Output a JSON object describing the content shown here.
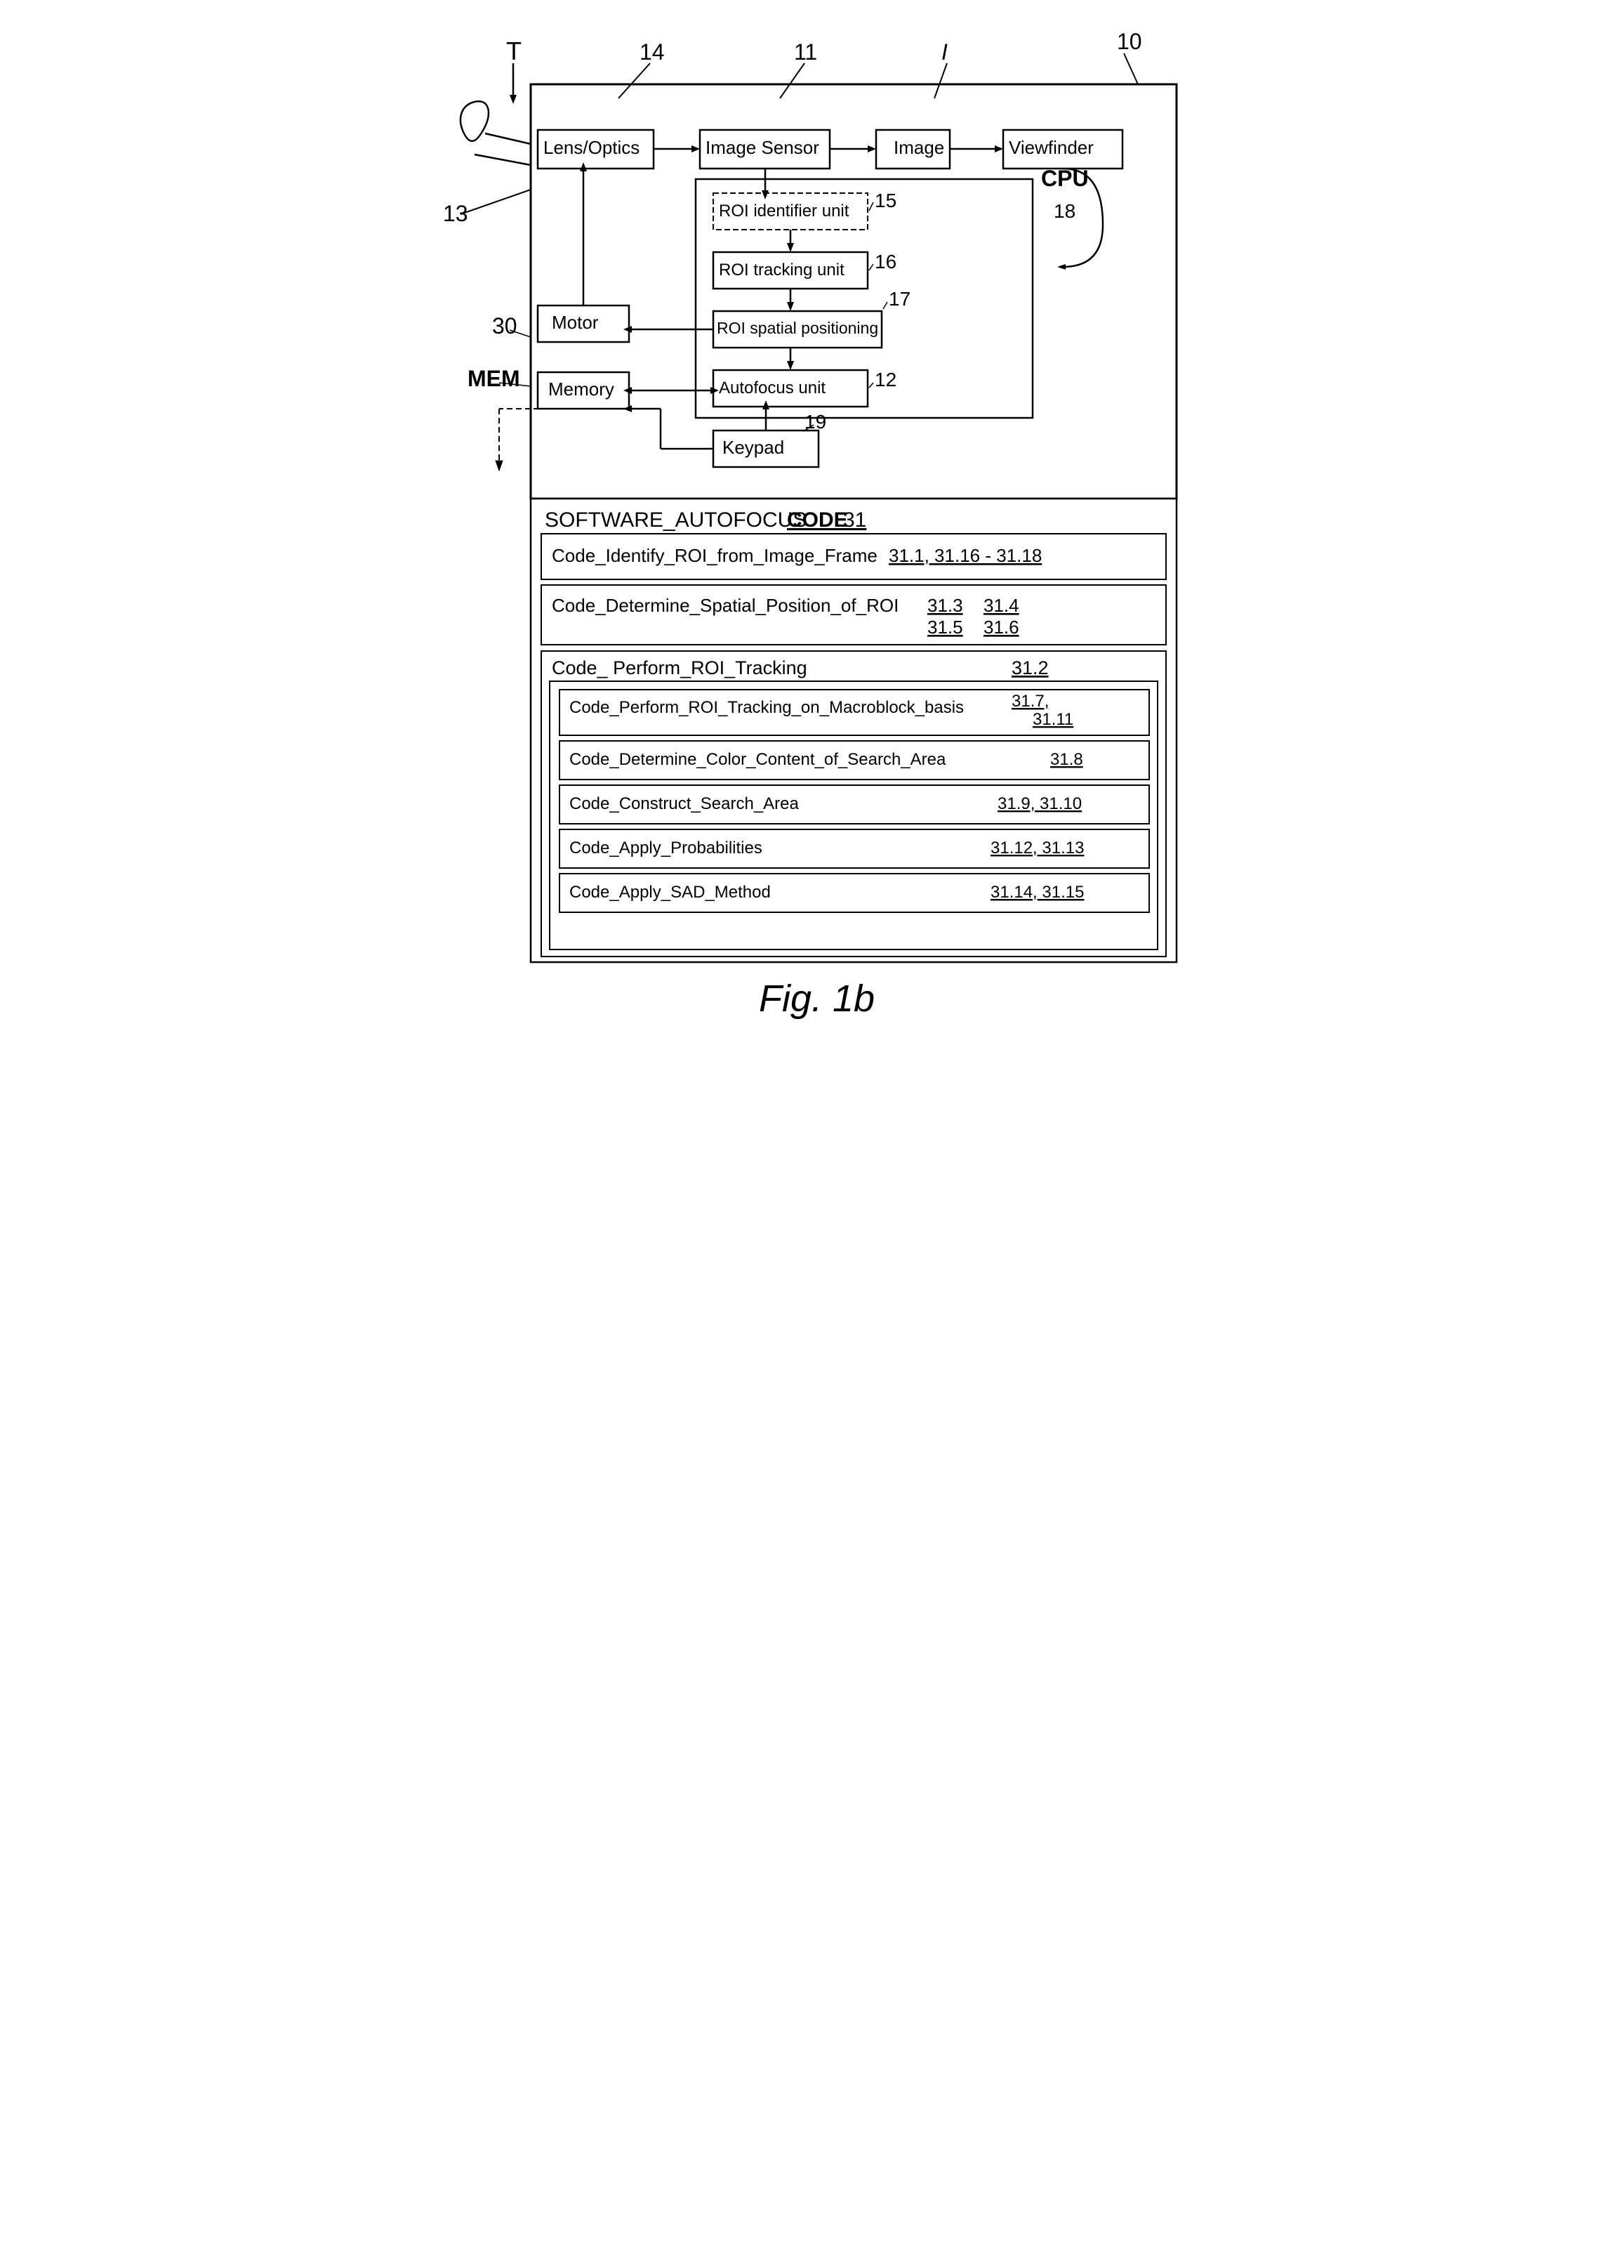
{
  "page": {
    "title": "Fig. 1b",
    "background": "#ffffff"
  },
  "refs": {
    "T": "T",
    "ref14": "14",
    "ref11": "11",
    "refI": "I",
    "ref10": "10",
    "ref13": "13",
    "ref15": "15",
    "ref16": "16",
    "ref17": "17",
    "ref18": "18",
    "ref30": "30",
    "refMEM": "MEM",
    "ref12": "12",
    "ref19": "19",
    "ref31": "31"
  },
  "components": {
    "lens_optics": "Lens/Optics",
    "image_sensor": "Image Sensor",
    "image": "Image",
    "viewfinder": "Viewfinder",
    "roi_identifier": "ROI identifier unit",
    "roi_tracking": "ROI tracking unit",
    "roi_spatial": "ROI spatial positioning",
    "autofocus": "Autofocus unit",
    "motor": "Motor",
    "memory": "Memory",
    "keypad": "Keypad",
    "cpu_label": "CPU"
  },
  "software": {
    "title_prefix": "SOFTWARE_AUTOFOCUS",
    "title_code": "CODE",
    "title_ref": "31",
    "items": [
      {
        "label": "Code_Identify_ROI_from_Image_Frame",
        "ref": "31.1, 31.16 - 31.18",
        "has_box": true,
        "nested": false
      },
      {
        "label": "Code_Determine_Spatial_Position_of_ROI",
        "ref": "31.3  31.4\n31.5  31.6",
        "ref_display": "31.3    31.4\n31.5    31.6",
        "has_box": true,
        "nested": false
      },
      {
        "label": "Code_ Perform_ROI_Tracking",
        "ref": "31.2",
        "has_box": false,
        "nested": false,
        "is_outer": true
      }
    ],
    "nested_items": [
      {
        "label": "Code_Perform_ROI_Tracking_on_Macroblock_basis",
        "ref": "31.7, 31.11"
      },
      {
        "label": "Code_Determine_Color_Content_of_Search_Area",
        "ref": "31.8"
      },
      {
        "label": "Code_Construct_Search_Area",
        "ref": "31.9, 31.10"
      },
      {
        "label": "Code_Apply_Probabilities",
        "ref": "31.12, 31.13"
      },
      {
        "label": "Code_Apply_SAD_Method",
        "ref": "31.14, 31.15"
      }
    ]
  },
  "figure_label": "Fig. 1b"
}
